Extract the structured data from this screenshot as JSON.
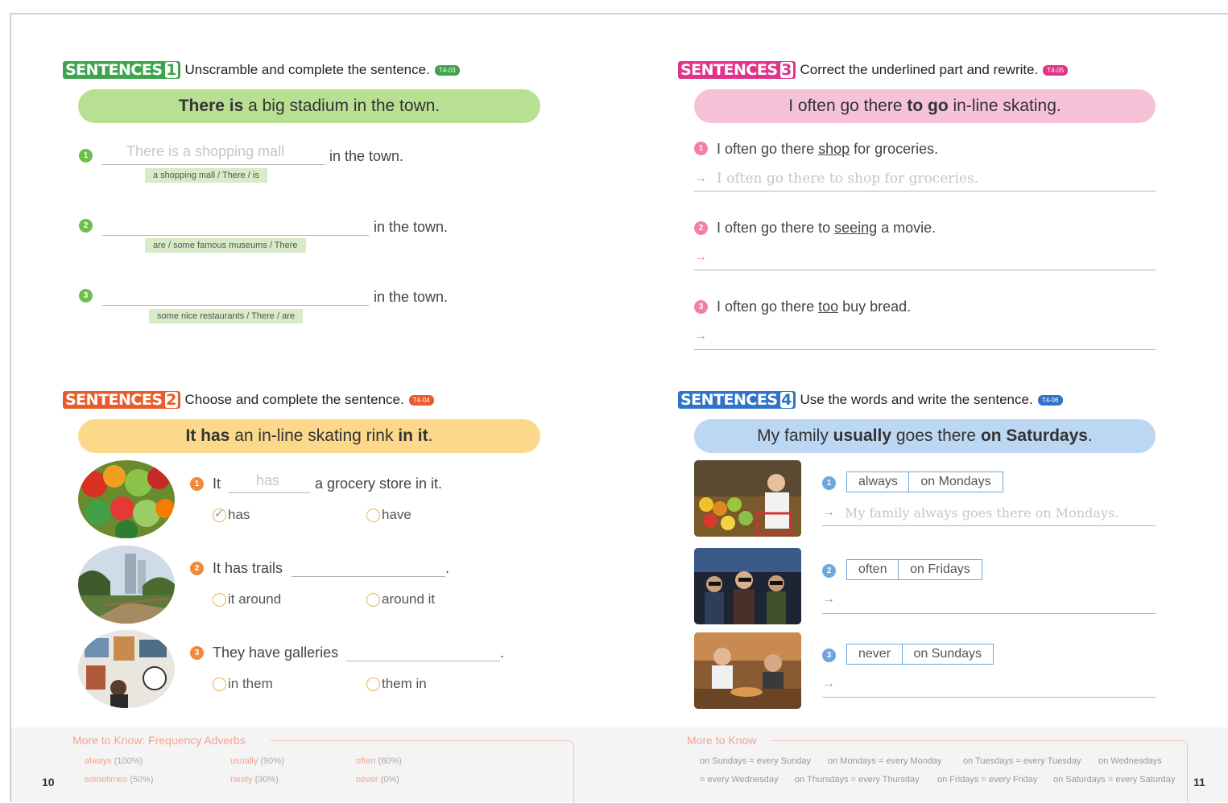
{
  "page": {
    "left_number": "10",
    "right_number": "11"
  },
  "s1": {
    "tag": "SENTENCES",
    "num": "1",
    "instruction": "Unscramble and complete the sentence.",
    "track": "T4-03",
    "model": {
      "a": "There is",
      "b": " a big stadium in the town."
    },
    "items": [
      {
        "n": "1",
        "answer": "There is a shopping mall",
        "tail": "in the town.",
        "hint": "a shopping mall / There / is"
      },
      {
        "n": "2",
        "answer": "",
        "tail": "in the town.",
        "hint": "are / some famous museums / There"
      },
      {
        "n": "3",
        "answer": "",
        "tail": "in the town.",
        "hint": "some nice restaurants / There / are"
      }
    ]
  },
  "s2": {
    "tag": "SENTENCES",
    "num": "2",
    "instruction": "Choose and complete the sentence.",
    "track": "T4-04",
    "model": {
      "a": "It has",
      "b": " an in-line skating rink ",
      "c": "in it",
      "d": "."
    },
    "items": [
      {
        "n": "1",
        "pre": "It",
        "answer": "has",
        "tail": "a grocery store in it.",
        "opt1": "has",
        "opt2": "have",
        "checked": 1
      },
      {
        "n": "2",
        "pre": "It has trails",
        "tail": ".",
        "opt1": "it around",
        "opt2": "around it"
      },
      {
        "n": "3",
        "pre": "They have galleries",
        "tail": ".",
        "opt1": "in them",
        "opt2": "them in"
      }
    ]
  },
  "s3": {
    "tag": "SENTENCES",
    "num": "3",
    "instruction": "Correct the underlined part and rewrite.",
    "track": "T4-05",
    "model": {
      "a": "I often go there ",
      "b": "to go",
      "c": " in-line skating."
    },
    "items": [
      {
        "n": "1",
        "pre": "I often go there ",
        "under": "shop",
        "post": " for groceries.",
        "answer": "I often go there to shop for groceries."
      },
      {
        "n": "2",
        "pre": "I often go there to ",
        "under": "seeing",
        "post": " a movie.",
        "answer": ""
      },
      {
        "n": "3",
        "pre": "I often go there ",
        "under": "too",
        "post": " buy bread.",
        "answer": ""
      }
    ]
  },
  "s4": {
    "tag": "SENTENCES",
    "num": "4",
    "instruction": "Use the words and write the sentence.",
    "track": "T4-06",
    "model": {
      "a": "My family ",
      "b": "usually",
      "c": " goes there ",
      "d": "on Saturdays",
      "e": "."
    },
    "items": [
      {
        "n": "1",
        "w1": "always",
        "w2": "on Mondays",
        "answer": "My family always goes there on Mondays."
      },
      {
        "n": "2",
        "w1": "often",
        "w2": "on Fridays",
        "answer": ""
      },
      {
        "n": "3",
        "w1": "never",
        "w2": "on Sundays",
        "answer": ""
      }
    ]
  },
  "more_left": {
    "title": "More to Know: Frequency Adverbs",
    "items": [
      {
        "word": "always",
        "pct": "(100%)"
      },
      {
        "word": "usually",
        "pct": "(90%)"
      },
      {
        "word": "often",
        "pct": "(60%)"
      },
      {
        "word": "sometimes",
        "pct": "(50%)"
      },
      {
        "word": "rarely",
        "pct": "(30%)"
      },
      {
        "word": "never",
        "pct": "(0%)"
      }
    ]
  },
  "more_right": {
    "title": "More to Know",
    "row1": [
      "on Sundays = every Sunday",
      "on Mondays = every Monday",
      "on Tuesdays = every Tuesday",
      "on Wednesdays"
    ],
    "row2": [
      "= every Wednesday",
      "on Thursdays = every Thursday",
      "on Fridays = every Friday",
      "on Saturdays = every Saturday"
    ]
  },
  "colors": {
    "green": "#3fa34d",
    "red": "#e85c2c",
    "pink": "#e0348a",
    "blue": "#2f73c8",
    "green_banner": "#b9df93",
    "yellow_banner": "#fcd98a",
    "pink_banner": "#f6c2d8",
    "blue_banner": "#bcd7f1"
  }
}
